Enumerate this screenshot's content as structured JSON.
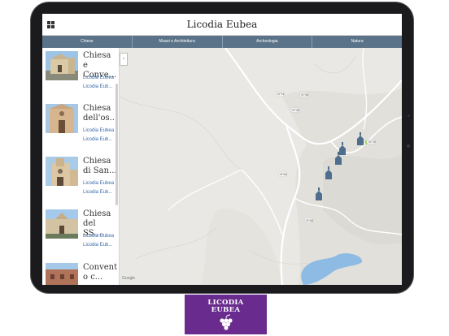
{
  "app": {
    "title": "Licodia Eubea"
  },
  "tabs": [
    {
      "label": "Chiese"
    },
    {
      "label": "Musei e Architettura"
    },
    {
      "label": "Archeologia"
    },
    {
      "label": "Natura"
    }
  ],
  "list": {
    "items": [
      {
        "title": "Chiesa e Conve...",
        "line1": "Licodia Eubea",
        "line2": "Licodia Eub..."
      },
      {
        "title": "Chiesa dell'os...",
        "line1": "Licodia Eubea",
        "line2": "Licodia Eub..."
      },
      {
        "title": "Chiesa di San...",
        "line1": "Licodia Eubea",
        "line2": "Licodia Eub..."
      },
      {
        "title": "Chiesa del SS....",
        "line1": "Licodia Eubea",
        "line2": "Licodia Eub..."
      },
      {
        "title": "Convent o c...",
        "line1": "",
        "line2": ""
      }
    ]
  },
  "map": {
    "road_labels": [
      "SP91",
      "SP38",
      "SP38",
      "SP39",
      "SP66",
      "SP68"
    ],
    "markers": 5,
    "colors": {
      "land": "#e9e8e4",
      "road": "#ffffff",
      "water": "#8ebbe3",
      "marker": "#4e6e8e"
    }
  },
  "logo": {
    "line1": "LICODIA",
    "line2": "EUBEA",
    "icon": "grapes-icon",
    "color": "#6a2b8e"
  }
}
